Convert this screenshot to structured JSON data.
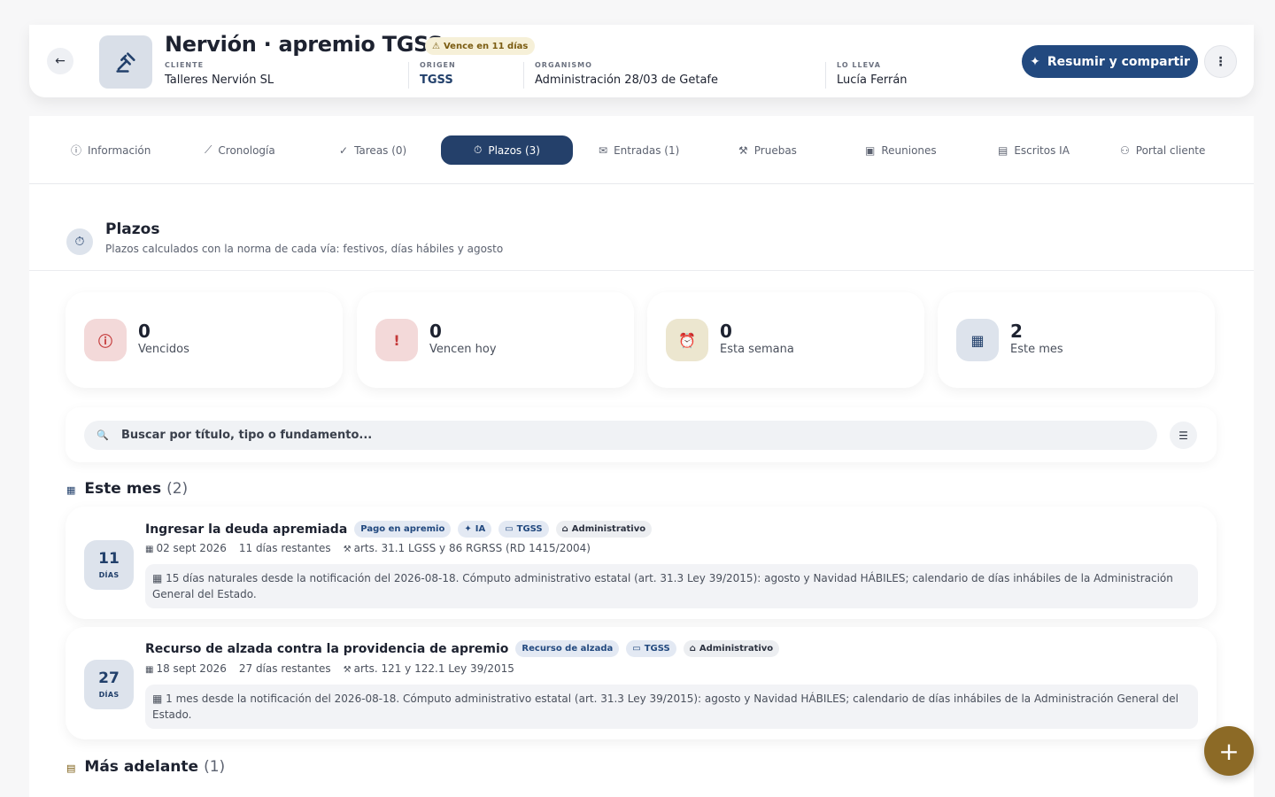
{
  "header": {
    "back_icon": "arrow-left-icon",
    "case_icon": "gavel-icon",
    "title": "Nervión · apremio TGSS",
    "alert_badge": "Vence en 11 días",
    "client_label": "CLIENTE",
    "client_value": "Talleres Nervión SL",
    "origin_label": "ORIGEN",
    "origin_value": "TGSS",
    "agency_label": "ORGANISMO",
    "agency_value": "Administración 28/03 de Getafe",
    "owner_label": "LO LLEVA",
    "owner_value": "Lucía Ferrán",
    "share_label": "Resumir y compartir"
  },
  "tabs": [
    {
      "label": "Información",
      "icon": "info-icon"
    },
    {
      "label": "Cronología",
      "icon": "timeline-icon"
    },
    {
      "label": "Tareas (0)",
      "icon": "check-circle-icon"
    },
    {
      "label": "Plazos (3)",
      "icon": "timer-icon",
      "active": true
    },
    {
      "label": "Entradas (1)",
      "icon": "mail-icon"
    },
    {
      "label": "Pruebas",
      "icon": "gavel-icon"
    },
    {
      "label": "Reuniones",
      "icon": "video-icon"
    },
    {
      "label": "Escritos IA",
      "icon": "document-icon"
    },
    {
      "label": "Portal cliente",
      "icon": "users-icon"
    }
  ],
  "section": {
    "title": "Plazos",
    "subtitle": "Plazos calculados con la norma de cada vía: festivos, días hábiles y agosto"
  },
  "stats": [
    {
      "value": "0",
      "label": "Vencidos",
      "color": "#f3d9d9"
    },
    {
      "value": "0",
      "label": "Vencen hoy",
      "color": "#f3d9d9"
    },
    {
      "value": "0",
      "label": "Esta semana",
      "color": "#ece6cf"
    },
    {
      "value": "2",
      "label": "Este mes",
      "color": "#dde3ec"
    }
  ],
  "search": {
    "placeholder": "Buscar por título, tipo o fundamento..."
  },
  "groups": [
    {
      "title": "Este mes",
      "count": "(2)"
    },
    {
      "title": "Más adelante",
      "count": "(1)"
    }
  ],
  "deadlines": [
    {
      "days": "11",
      "days_label": "DÍAS",
      "title": "Ingresar la deuda apremiada",
      "chips": [
        "Pago en apremio",
        "IA",
        "TGSS",
        "Administrativo"
      ],
      "date": "02 sept 2026",
      "remaining": "11 días restantes",
      "basis": "arts. 31.1 LGSS y 86 RGRSS (RD 1415/2004)",
      "note": "15 días naturales desde la notificación del 2026-08-18. Cómputo administrativo estatal (art. 31.3 Ley 39/2015): agosto y Navidad HÁBILES; calendario de días inhábiles de la Administración General del Estado."
    },
    {
      "days": "27",
      "days_label": "DÍAS",
      "title": "Recurso de alzada contra la providencia de apremio",
      "chips": [
        "Recurso de alzada",
        "TGSS",
        "Administrativo"
      ],
      "date": "18 sept 2026",
      "remaining": "27 días restantes",
      "basis": "arts. 121 y 122.1 Ley 39/2015",
      "note": "1 mes desde la notificación del 2026-08-18. Cómputo administrativo estatal (art. 31.3 Ley 39/2015): agosto y Navidad HÁBILES; calendario de días inhábiles de la Administración General del Estado."
    }
  ],
  "fab_icon": "plus-icon"
}
